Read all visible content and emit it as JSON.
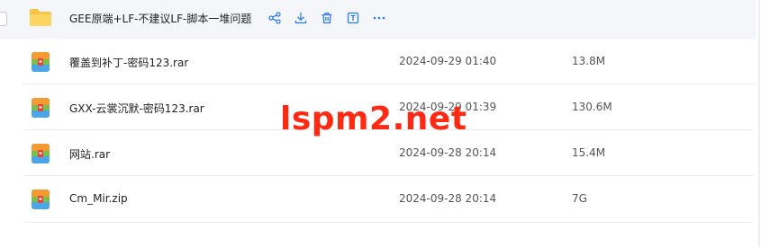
{
  "accent": "#2b7cf6",
  "watermark_text": "lspm2.net",
  "selected_row": {
    "name": "GEE原端+LF-不建议LF-脚本一堆问题",
    "icon": "folder-icon",
    "actions": [
      "share-icon",
      "download-icon",
      "delete-icon",
      "rename-icon",
      "more-icon"
    ]
  },
  "files": [
    {
      "name": "覆盖到补丁-密码123.rar",
      "date": "2024-09-29 01:40",
      "size": "13.8M",
      "icon": "archive-icon"
    },
    {
      "name": "GXX-云裳沉默-密码123.rar",
      "date": "2024-09-29 01:39",
      "size": "130.6M",
      "icon": "archive-icon"
    },
    {
      "name": "网站.rar",
      "date": "2024-09-28 20:14",
      "size": "15.4M",
      "icon": "archive-icon"
    },
    {
      "name": "Cm_Mir.zip",
      "date": "2024-09-28 20:14",
      "size": "7G",
      "icon": "archive-icon"
    }
  ]
}
